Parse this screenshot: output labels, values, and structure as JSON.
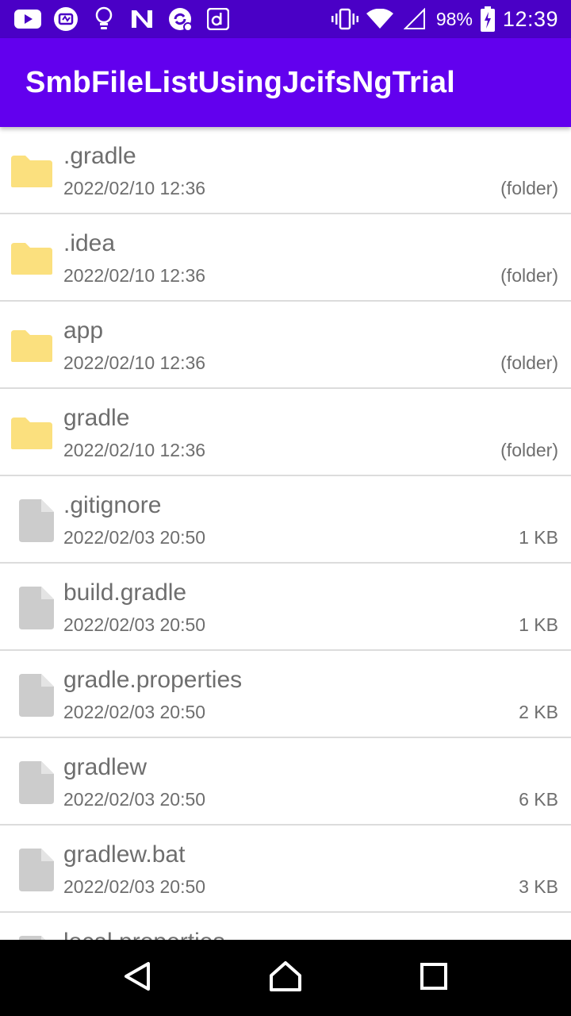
{
  "status_bar": {
    "battery_percent": "98%",
    "time": "12:39",
    "left_icons": [
      "youtube-icon",
      "tv-icon",
      "lightbulb-icon",
      "n-app-icon",
      "sync-icon",
      "d-app-icon"
    ],
    "right_icons": [
      "vibrate-icon",
      "wifi-icon",
      "signal-icon",
      "battery-charging-icon"
    ]
  },
  "app_bar": {
    "title": "SmbFileListUsingJcifsNgTrial"
  },
  "colors": {
    "status_bar": "#4a00c6",
    "app_bar": "#6200ee",
    "folder_icon": "#fbe07e",
    "file_icon": "#cccccc",
    "text": "#6e6e6e"
  },
  "files": [
    {
      "name": ".gradle",
      "date": "2022/02/10 12:36",
      "size": "(folder)",
      "icon": "folder-icon"
    },
    {
      "name": ".idea",
      "date": "2022/02/10 12:36",
      "size": "(folder)",
      "icon": "folder-icon"
    },
    {
      "name": "app",
      "date": "2022/02/10 12:36",
      "size": "(folder)",
      "icon": "folder-icon"
    },
    {
      "name": "gradle",
      "date": "2022/02/10 12:36",
      "size": "(folder)",
      "icon": "folder-icon"
    },
    {
      "name": ".gitignore",
      "date": "2022/02/03 20:50",
      "size": "1 KB",
      "icon": "file-icon"
    },
    {
      "name": "build.gradle",
      "date": "2022/02/03 20:50",
      "size": "1 KB",
      "icon": "file-icon"
    },
    {
      "name": "gradle.properties",
      "date": "2022/02/03 20:50",
      "size": "2 KB",
      "icon": "file-icon"
    },
    {
      "name": "gradlew",
      "date": "2022/02/03 20:50",
      "size": "6 KB",
      "icon": "file-icon"
    },
    {
      "name": "gradlew.bat",
      "date": "2022/02/03 20:50",
      "size": "3 KB",
      "icon": "file-icon"
    },
    {
      "name": "local.properties",
      "date": "",
      "size": "",
      "icon": "file-icon"
    }
  ],
  "nav_bar": {
    "buttons": [
      "back-icon",
      "home-icon",
      "recents-icon"
    ]
  }
}
